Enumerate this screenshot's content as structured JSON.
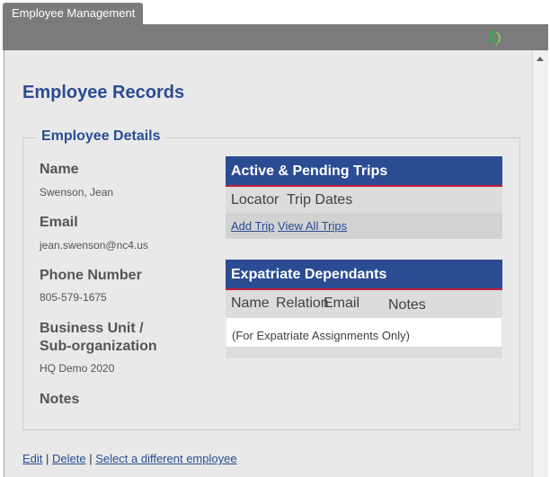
{
  "tab": {
    "label": "Employee Management"
  },
  "page": {
    "title": "Employee Records"
  },
  "details": {
    "legend": "Employee Details",
    "fields": [
      {
        "label": "Name",
        "value": "Swenson, Jean"
      },
      {
        "label": "Email",
        "value": "jean.swenson@nc4.us"
      },
      {
        "label": "Phone Number",
        "value": "805-579-1675"
      },
      {
        "label_line1": "Business Unit /",
        "label_line2": "Sub-organization",
        "value": "HQ Demo 2020"
      },
      {
        "label": "Notes"
      }
    ]
  },
  "trips": {
    "title": "Active & Pending Trips",
    "columns": [
      "Locator",
      "Trip Dates"
    ],
    "add_link": "Add Trip",
    "view_link": "View All Trips"
  },
  "dependants": {
    "title": "Expatriate Dependants",
    "columns": [
      "Name",
      "Relation",
      "Email",
      "Notes"
    ],
    "info": "(For Expatriate Assignments Only)"
  },
  "footer": {
    "edit": "Edit",
    "delete": "Delete",
    "select": "Select a different employee",
    "separator": "|"
  },
  "colors": {
    "header_blue": "#2b4c93",
    "accent_red": "#c0203b",
    "panel_bg": "#e9e9e9"
  },
  "icons": {
    "refresh": "refresh-icon"
  }
}
